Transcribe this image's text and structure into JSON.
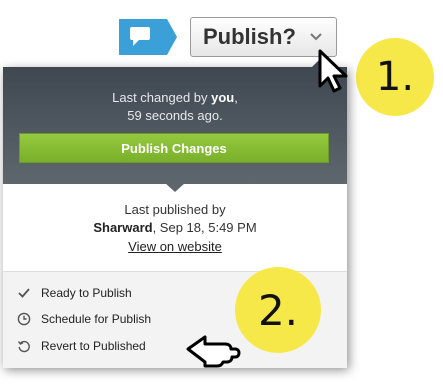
{
  "toolbar": {
    "comment_icon": "speech-bubble-icon",
    "publish_button_label": "Publish?",
    "chevron_icon": "chevron-down-icon"
  },
  "badges": {
    "step1": "1.",
    "step2": "2."
  },
  "panel": {
    "last_changed_prefix": "Last changed by",
    "last_changed_user": "you",
    "last_changed_suffix": ",",
    "last_changed_time": "59 seconds ago.",
    "publish_changes_label": "Publish Changes",
    "last_published_label": "Last published by",
    "published_by_user": "Sharward",
    "published_date": ", Sep 18, 5:49 PM",
    "view_on_website": "View on website"
  },
  "actions": [
    {
      "label": "Ready to Publish",
      "icon": "checkmark-icon"
    },
    {
      "label": "Schedule for Publish",
      "icon": "clock-icon"
    },
    {
      "label": "Revert to Published",
      "icon": "revert-icon"
    }
  ],
  "colors": {
    "accent_green": "#86bd34",
    "header_dark": "#4a525a",
    "comment_blue": "#3b9fd8",
    "badge_yellow": "#f7e84a"
  }
}
